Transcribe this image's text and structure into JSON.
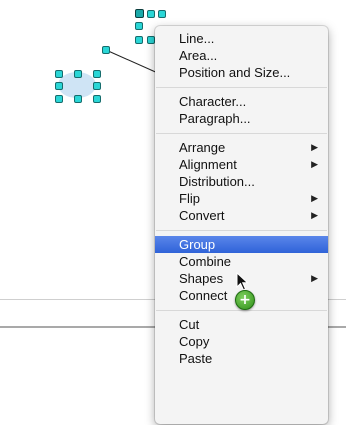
{
  "context_menu": {
    "sections": [
      [
        {
          "label": "Line...",
          "submenu": false
        },
        {
          "label": "Area...",
          "submenu": false
        },
        {
          "label": "Position and Size...",
          "submenu": false
        }
      ],
      [
        {
          "label": "Character...",
          "submenu": false
        },
        {
          "label": "Paragraph...",
          "submenu": false
        }
      ],
      [
        {
          "label": "Arrange",
          "submenu": true
        },
        {
          "label": "Alignment",
          "submenu": true
        },
        {
          "label": "Distribution...",
          "submenu": false
        },
        {
          "label": "Flip",
          "submenu": true
        },
        {
          "label": "Convert",
          "submenu": true
        }
      ],
      [
        {
          "label": "Group",
          "submenu": false,
          "highlighted": true
        },
        {
          "label": "Combine",
          "submenu": false
        },
        {
          "label": "Shapes",
          "submenu": true
        },
        {
          "label": "Connect",
          "submenu": false
        }
      ],
      [
        {
          "label": "Cut",
          "submenu": false
        },
        {
          "label": "Copy",
          "submenu": false
        },
        {
          "label": "Paste",
          "submenu": false
        }
      ]
    ],
    "highlight_color": "#3b6fe0"
  },
  "icons": {
    "submenu_arrow": "▶",
    "add_badge": "+"
  },
  "colors": {
    "handle_fill": "#2ad6d6",
    "shape_fill": "#cfe4f5"
  }
}
